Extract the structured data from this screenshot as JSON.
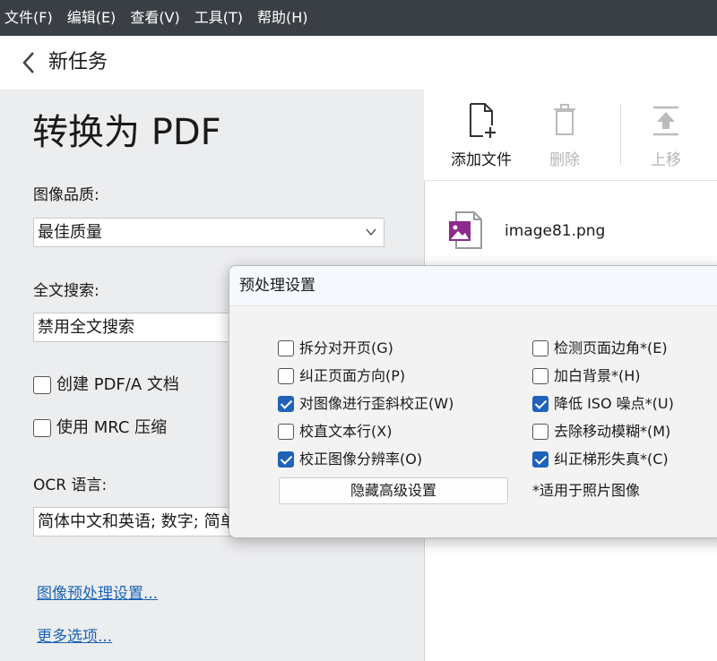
{
  "menu": [
    "文件(F)",
    "编辑(E)",
    "查看(V)",
    "工具(T)",
    "帮助(H)"
  ],
  "header": {
    "title": "新任务",
    "back_icon": "chevron-left-icon"
  },
  "left": {
    "heading": "转换为 PDF",
    "image_quality_label": "图像品质:",
    "image_quality_value": "最佳质量",
    "fulltext_label": "全文搜索:",
    "fulltext_value": "禁用全文搜索",
    "pdfa_label": "创建 PDF/A 文档",
    "pdfa_checked": false,
    "mrc_label": "使用 MRC 压缩",
    "mrc_checked": false,
    "ocr_label": "OCR 语言:",
    "ocr_value": "简体中文和英语; 数字; 简单",
    "link_preprocess": "图像预处理设置...",
    "link_more": "更多选项..."
  },
  "toolbar": {
    "add_label": "添加文件",
    "delete_label": "删除",
    "up_label": "上移"
  },
  "files": [
    {
      "name": "image81.png",
      "icon": "image-file-icon"
    }
  ],
  "dialog": {
    "title": "预处理设置",
    "left_options": [
      {
        "label": "拆分对开页(G)",
        "checked": false
      },
      {
        "label": "纠正页面方向(P)",
        "checked": false
      },
      {
        "label": "对图像进行歪斜校正(W)",
        "checked": true
      },
      {
        "label": "校直文本行(X)",
        "checked": false
      },
      {
        "label": "校正图像分辨率(O)",
        "checked": true
      }
    ],
    "right_options": [
      {
        "label": "检测页面边角*(E)",
        "checked": false
      },
      {
        "label": "加白背景*(H)",
        "checked": false
      },
      {
        "label": "降低 ISO 噪点*(U)",
        "checked": true
      },
      {
        "label": "去除移动模糊*(M)",
        "checked": false
      },
      {
        "label": "纠正梯形失真*(C)",
        "checked": true
      }
    ],
    "hide_button": "隐藏高级设置",
    "note": "*适用于照片图像"
  },
  "colors": {
    "menubar": "#3a3f45",
    "accent": "#1f63b8",
    "link": "#1a63b6",
    "file_icon": "#8e2a8c"
  }
}
